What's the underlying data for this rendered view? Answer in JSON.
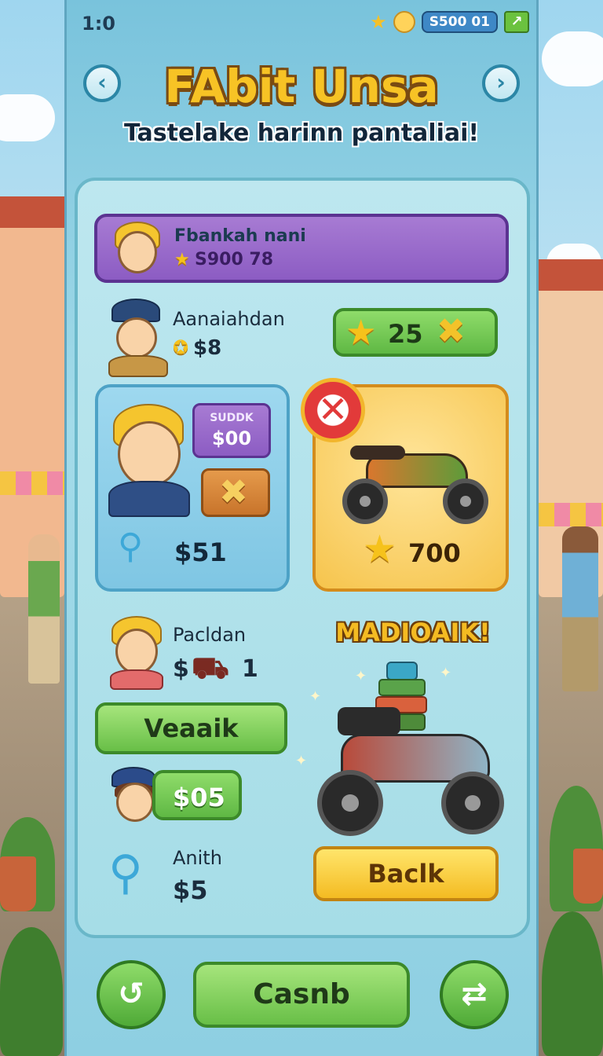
{
  "status": {
    "time": "1:0",
    "coins": "S500 01"
  },
  "header": {
    "title": "FAbit Unsa",
    "subtitle": "Tastelake harinn pantaliai!",
    "prev_icon": "chevron-left-icon",
    "next_icon": "chevron-right-icon"
  },
  "player_bar": {
    "name": "Fbankah nani",
    "score": "S900 78"
  },
  "row1": {
    "name": "Aanaiahdan",
    "amount": "$8",
    "pill_value": "25"
  },
  "offer_card": {
    "tag_label": "SUDDK",
    "tag_value": "$00",
    "amount": "$51"
  },
  "prize_card": {
    "value": "700"
  },
  "row2": {
    "name": "Pacldan",
    "amount_prefix": "$",
    "amount_suffix": "1",
    "button": "Veaaik"
  },
  "row3": {
    "amount": "$05"
  },
  "row4": {
    "name": "Anith",
    "amount": "$5"
  },
  "showcase": {
    "label": "MADIOAIK!",
    "back_button": "Baclk"
  },
  "footer": {
    "main_button": "Casnb",
    "left_icon": "undo-icon",
    "right_icon": "share-icon"
  },
  "colors": {
    "title": "#f7c325",
    "panel": "#a3dbe9",
    "green": "#68bf47",
    "purple": "#8c5cc3",
    "gold": "#f6c44c"
  }
}
